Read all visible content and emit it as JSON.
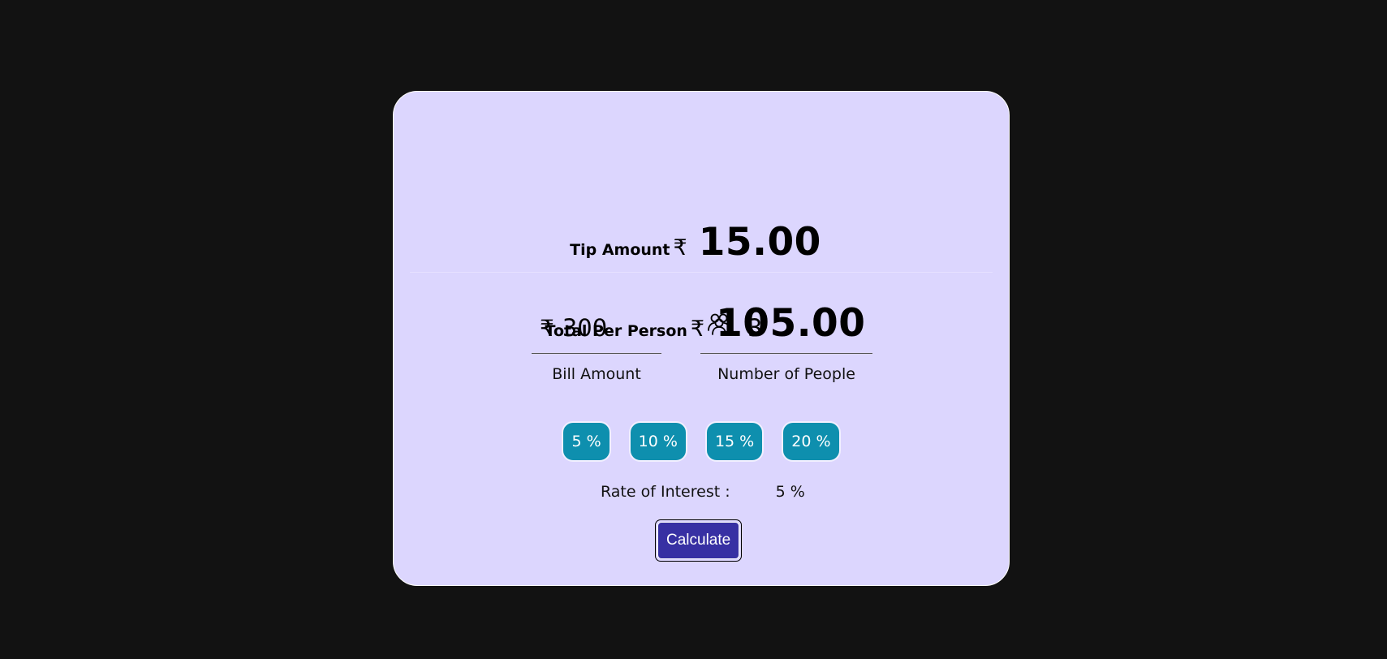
{
  "results": {
    "tip_label": "Tip Amount",
    "tip_currency": "₹",
    "tip_value": "15.00",
    "total_label": "Total Per Person",
    "total_currency": "₹",
    "total_value": "105.00"
  },
  "bill": {
    "currency": "₹",
    "value": "300",
    "label": "Bill Amount"
  },
  "people": {
    "icon": "people-icon",
    "value": "3",
    "label": "Number of People"
  },
  "tip_buttons": [
    {
      "label": "5 %"
    },
    {
      "label": "10 %"
    },
    {
      "label": "15 %"
    },
    {
      "label": "20 %"
    }
  ],
  "rate": {
    "label": "Rate of Interest :",
    "value": "5 %"
  },
  "calculate_label": "Calculate",
  "colors": {
    "page_background": "#121212",
    "card_background": "#dcd6fe",
    "tip_button": "#0e8fae",
    "calculate_button": "#3730a3"
  }
}
